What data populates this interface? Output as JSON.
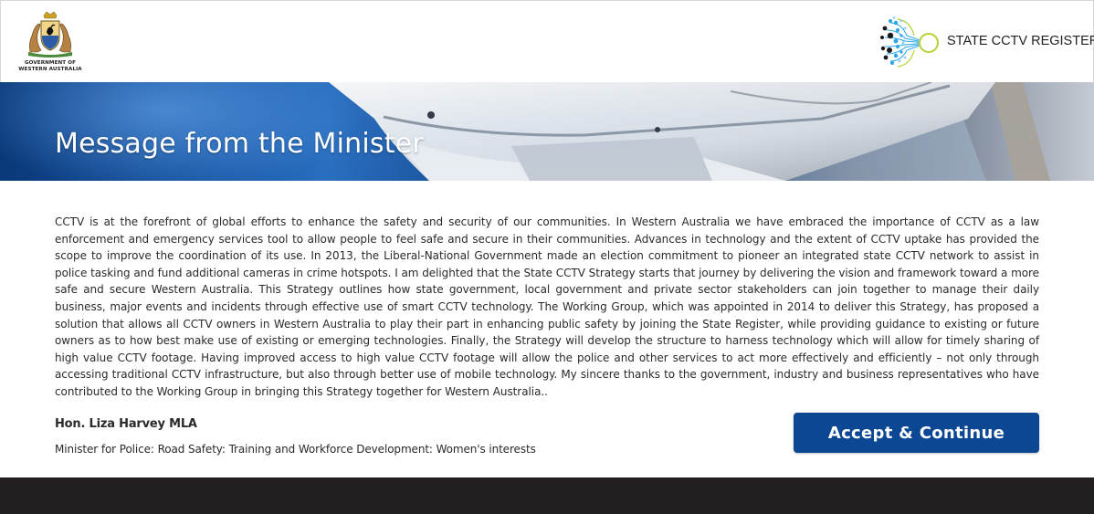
{
  "header": {
    "gov_logo": {
      "icon": "wa-coat-of-arms-icon",
      "line1": "GOVERNMENT OF",
      "line2": "WESTERN AUSTRALIA"
    },
    "brand": {
      "icon": "cctv-network-icon",
      "label": "STATE CCTV REGISTER"
    }
  },
  "banner": {
    "title": "Message from the Minister",
    "image": "cctv-camera-photo"
  },
  "message": {
    "body": "CCTV is at the forefront of global efforts to enhance the safety and security of our communities. In Western Australia we have embraced the importance of CCTV as a law enforcement and emergency services tool to allow people to feel safe and secure in their communities. Advances in technology and the extent of CCTV uptake has provided the scope to improve the coordination of its use. In 2013, the Liberal-National Government made an election commitment to pioneer an integrated state CCTV network to assist in police tasking and fund additional cameras in crime hotspots. I am delighted that the State CCTV Strategy starts that journey by delivering the vision and framework toward a more safe and secure Western Australia. This Strategy outlines how state government, local government and private sector stakeholders can join together to manage their daily business, major events and incidents through effective use of smart CCTV technology. The Working Group, which was appointed in 2014 to deliver this Strategy, has proposed a solution that allows all CCTV owners in Western Australia to play their part in enhancing public safety by joining the State Register, while providing guidance to existing or future owners as to how best make use of existing or emerging technologies. Finally, the Strategy will develop the structure to harness technology which will allow for timely sharing of high value CCTV footage. Having improved access to high value CCTV footage will allow the police and other services to act more effectively and efficiently – not only through accessing traditional CCTV infrastructure, but also through better use of mobile technology. My sincere thanks to the government, industry and business representatives who have contributed to the Working Group in bringing this Strategy together for Western Australia..",
    "signatory": "Hon. Liza Harvey MLA",
    "signatory_title": "Minister for Police: Road Safety: Training and Workforce Development: Women's interests"
  },
  "actions": {
    "accept_label": "Accept & Continue"
  },
  "colors": {
    "button": "#0c4793",
    "footer": "#231f20",
    "brand_accent_blue": "#1a9be0",
    "brand_accent_green": "#b5d334"
  }
}
